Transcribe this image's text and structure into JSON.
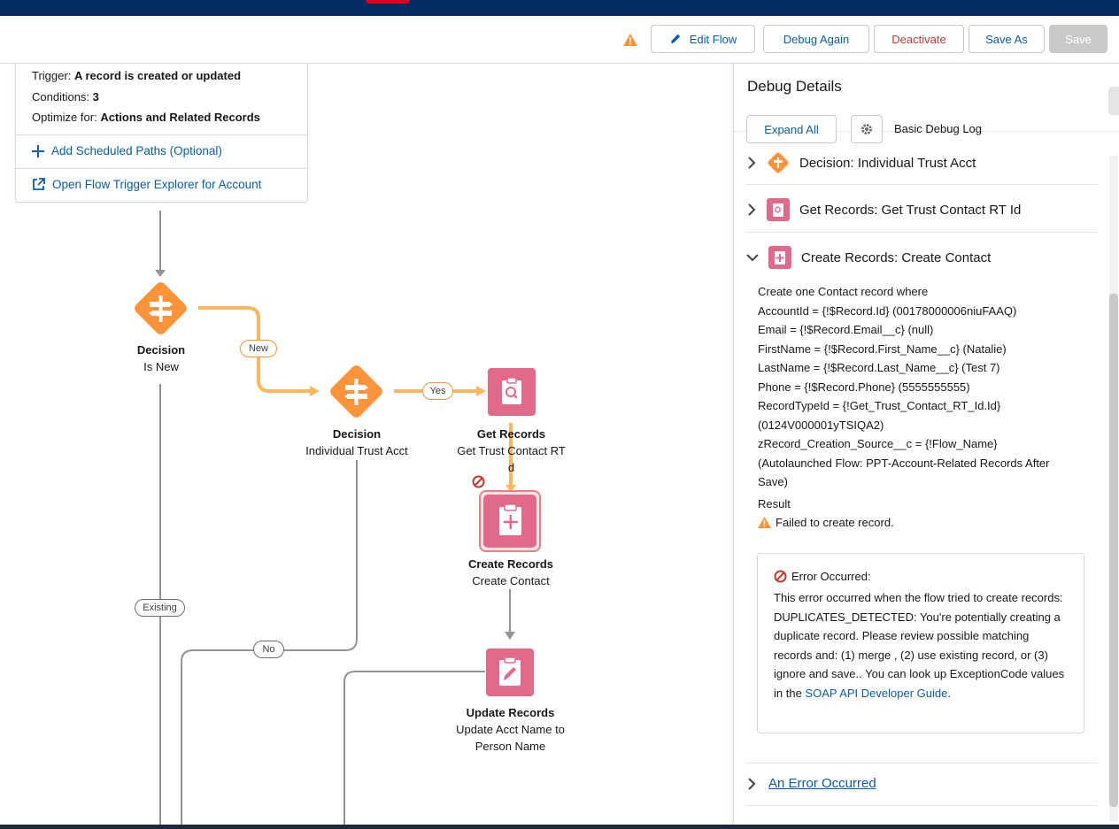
{
  "toolbar": {
    "edit_flow": "Edit Flow",
    "debug_again": "Debug Again",
    "deactivate": "Deactivate",
    "save_as": "Save As",
    "save": "Save"
  },
  "trigger": {
    "trigger_label": "Trigger:",
    "trigger_value": "A record is created or updated",
    "conditions_label": "Conditions:",
    "conditions_value": "3",
    "optimize_label": "Optimize for:",
    "optimize_value": "Actions and Related Records",
    "add_paths": "Add Scheduled Paths (Optional)",
    "open_explorer": "Open Flow Trigger Explorer for Account"
  },
  "nodes": {
    "decision1": {
      "type": "Decision",
      "name": "Is New"
    },
    "decision2": {
      "type": "Decision",
      "name": "Individual Trust Acct"
    },
    "get_records": {
      "type": "Get Records",
      "name": "Get Trust Contact RT",
      "name2": "d"
    },
    "create_records": {
      "type": "Create Records",
      "name": "Create Contact"
    },
    "update_records": {
      "type": "Update Records",
      "name": "Update Acct Name to",
      "name2": "Person Name"
    }
  },
  "connectors": {
    "new": "New",
    "yes": "Yes",
    "existing": "Existing",
    "no": "No"
  },
  "panel": {
    "title": "Debug Details",
    "expand_all": "Expand All",
    "log_level": "Basic Debug Log",
    "steps": [
      "Decision: Individual Trust Acct",
      "Get Records: Get Trust Contact RT Id",
      "Create Records: Create Contact",
      "An Error Occurred"
    ],
    "details": [
      "Create one Contact record where",
      "AccountId = {!$Record.Id} (00178000006niuFAAQ)",
      "Email = {!$Record.Email__c} (null)",
      "FirstName = {!$Record.First_Name__c} (Natalie)",
      "LastName = {!$Record.Last_Name__c} (Test 7)",
      "Phone = {!$Record.Phone} (5555555555)",
      "RecordTypeId = {!Get_Trust_Contact_RT_Id.Id}",
      "(0124V000001yTSIQA2)",
      "zRecord_Creation_Source__c = {!Flow_Name}",
      "(Autolaunched Flow: PPT-Account-Related Records After",
      "Save)",
      "Result"
    ],
    "result_text": "Failed to create record.",
    "error_title": "Error Occurred:",
    "error_text": "This error occurred when the flow tried to create records: DUPLICATES_DETECTED: You're potentially creating a duplicate record. Please review possible matching records and: (1) merge , (2) use existing record, or (3) ignore and save.. You can look up ExceptionCode values in the ",
    "error_link": "SOAP API Developer Guide",
    "error_end": "."
  },
  "colors": {
    "decision": "#fe9339",
    "records": "#e3698b",
    "link": "#0b5cab",
    "error": "#c23934",
    "brand_bar": "#032d60"
  }
}
